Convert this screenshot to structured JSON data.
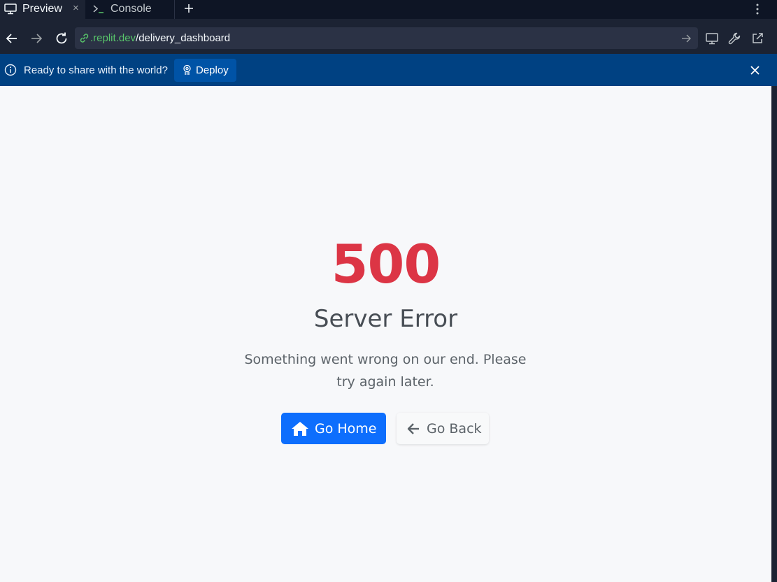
{
  "tabs": {
    "preview_label": "Preview",
    "console_label": "Console",
    "close_glyph": "×",
    "new_tab_glyph": "+"
  },
  "address_bar": {
    "domain": ".replit.dev",
    "path": "/delivery_dashboard"
  },
  "banner": {
    "message": "Ready to share with the world?",
    "deploy_label": "Deploy"
  },
  "error_page": {
    "code": "500",
    "title": "Server Error",
    "message": "Something went wrong on our end. Please try again later.",
    "home_button": "Go Home",
    "back_button": "Go Back"
  },
  "colors": {
    "error_red": "#dc3545",
    "primary_blue": "#0d6efd",
    "banner_blue": "#004182",
    "url_green": "#58c56a"
  },
  "icons": {
    "preview_tab": "monitor-icon",
    "console_tab": "terminal-icon",
    "back": "arrow-left-icon",
    "forward": "arrow-right-icon",
    "reload": "reload-icon",
    "link": "link-icon",
    "go": "arrow-right-icon",
    "devices": "monitor-icon",
    "devtools": "wrench-icon",
    "open_new": "external-link-icon",
    "menu": "kebab-menu-icon",
    "info": "info-icon",
    "deploy": "deploy-icon",
    "close": "close-icon",
    "home": "home-icon",
    "go_back": "arrow-left-icon"
  }
}
